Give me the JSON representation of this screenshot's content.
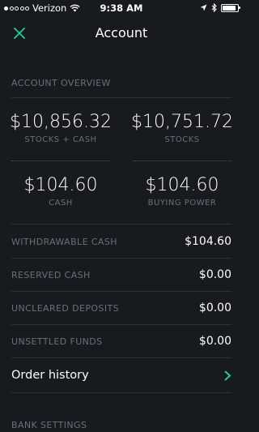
{
  "status_bar": {
    "carrier": "Verizon",
    "time": "9:38 AM",
    "signal_bars_filled": 1,
    "signal_bars_total": 5,
    "battery_level": 0.9
  },
  "nav": {
    "title": "Account",
    "close_icon": "close-icon",
    "accent_color": "#21ce99"
  },
  "overview": {
    "header": "ACCOUNT OVERVIEW",
    "stocks_cash": {
      "value": "$10,856.32",
      "label": "STOCKS + CASH"
    },
    "stocks": {
      "value": "$10,751.72",
      "label": "STOCKS"
    },
    "cash": {
      "value": "$104.60",
      "label": "CASH"
    },
    "buying_power": {
      "value": "$104.60",
      "label": "BUYING POWER"
    }
  },
  "details": [
    {
      "label": "WITHDRAWABLE CASH",
      "value": "$104.60"
    },
    {
      "label": "RESERVED CASH",
      "value": "$0.00"
    },
    {
      "label": "UNCLEARED DEPOSITS",
      "value": "$0.00"
    },
    {
      "label": "UNSETTLED FUNDS",
      "value": "$0.00"
    }
  ],
  "order_history": {
    "label": "Order history",
    "chevron_icon": "chevron-right-icon"
  },
  "bank_settings": {
    "header": "BANK SETTINGS"
  }
}
